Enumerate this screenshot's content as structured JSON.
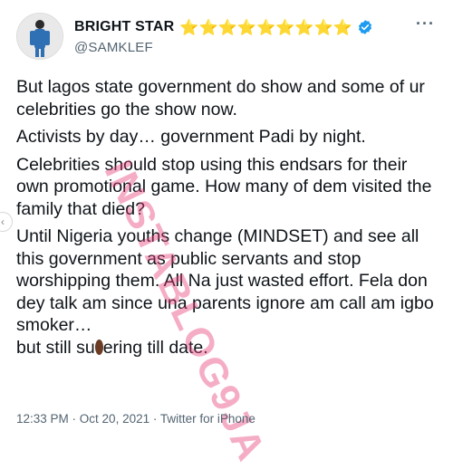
{
  "user": {
    "display_name": "BRIGHT STAR",
    "handle": "@SAMKLEF",
    "name_emoji": "⭐⭐⭐⭐⭐⭐⭐⭐⭐",
    "verified": true
  },
  "menu": {
    "more_label": "···"
  },
  "tweet": {
    "paragraphs": [
      "But lagos state government do show and some of ur celebrities go the show now.",
      "Activists by day… government Padi by night.",
      "Celebrities should stop using this endsars for their own promotional game. How many of dem visited the family that died?",
      "Until Nigeria youths change (MINDSET) and see all this government as public servants and stop worshipping them. All Na just wasted effort.  Fela don dey talk am since una parents ignore am call am igbo smoker…"
    ],
    "last_line_start": "but still su",
    "last_line_end": "ering till date."
  },
  "footer": {
    "time": "12:33 PM",
    "date": "Oct 20, 2021",
    "source": "Twitter for iPhone",
    "separator": " · "
  },
  "watermark": {
    "text": "INSTABLOG9JA"
  },
  "colors": {
    "text": "#0f1419",
    "secondary": "#536471",
    "star": "#f4a41d",
    "verified": "#1d9bf0",
    "watermark": "#e83c78"
  }
}
